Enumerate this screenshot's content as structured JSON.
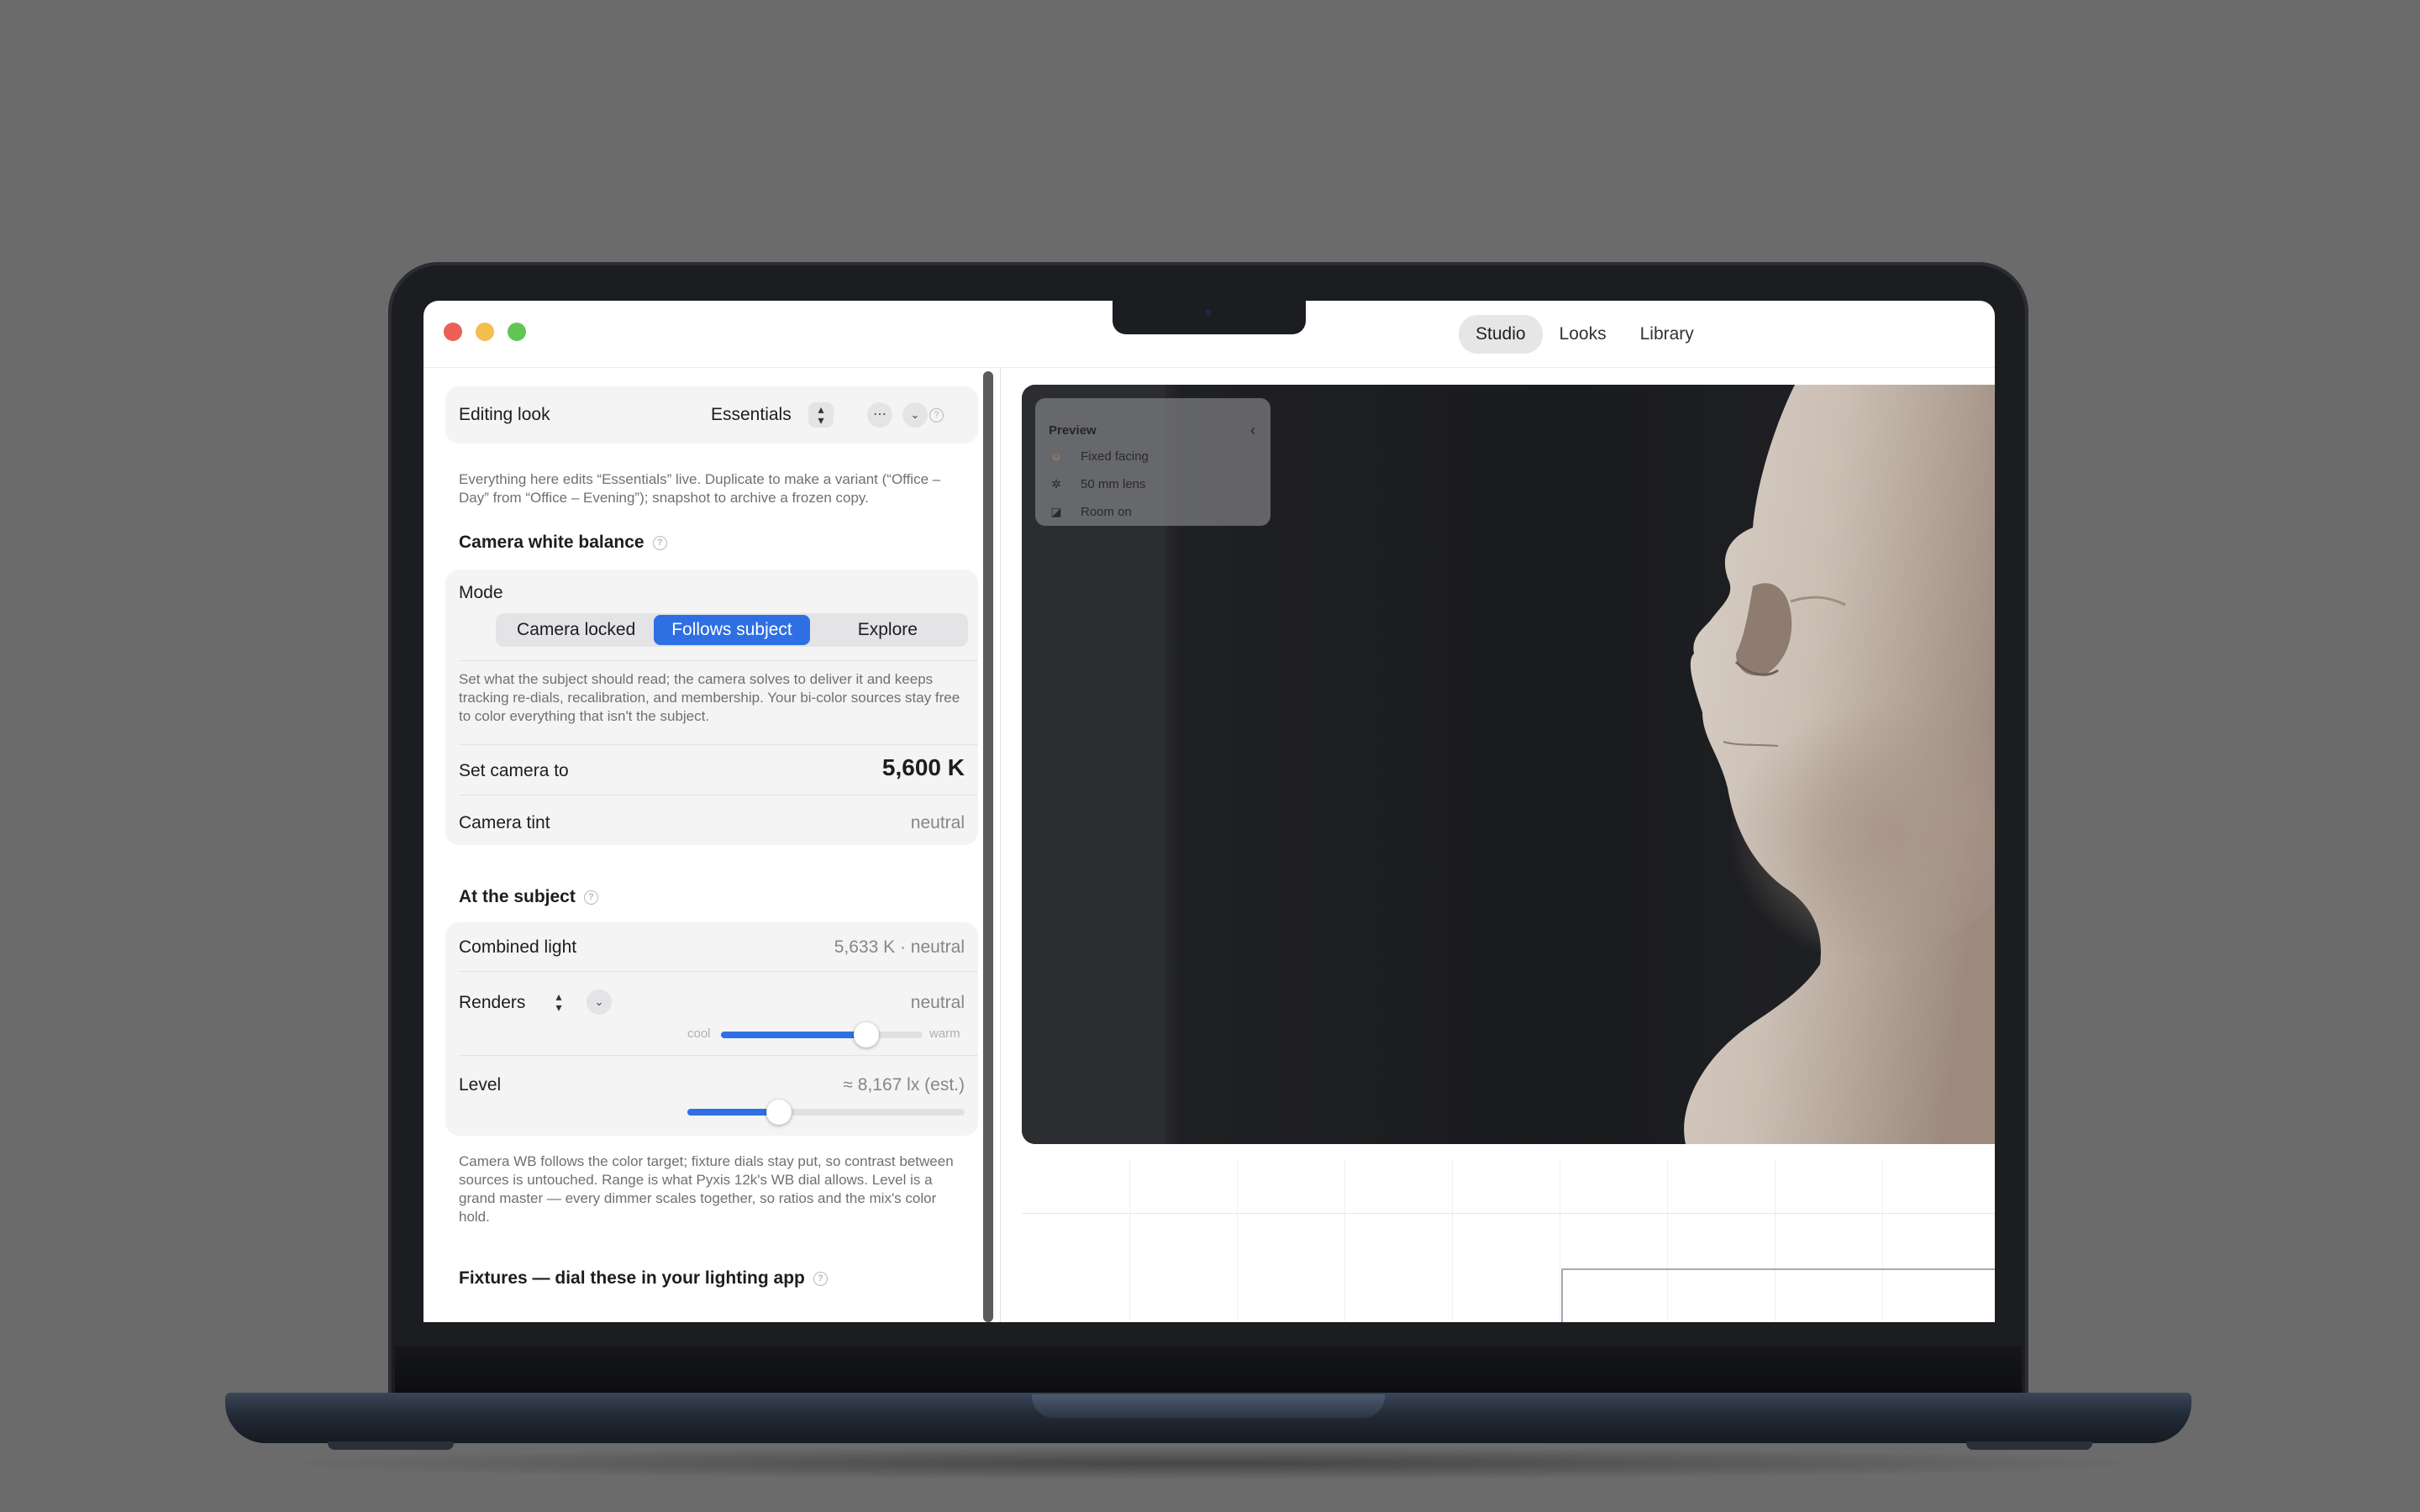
{
  "window": {
    "top_tabs": [
      "Studio",
      "Looks",
      "Library"
    ],
    "active_tab": "Studio"
  },
  "editing_look": {
    "label": "Editing look",
    "value": "Essentials",
    "hint": "Everything here edits “Essentials” live. Duplicate to make a variant (“Office – Day” from “Office – Evening”); snapshot to archive a frozen copy."
  },
  "camera_white_balance": {
    "title": "Camera white balance",
    "mode_label": "Mode",
    "modes": [
      "Camera locked",
      "Follows subject",
      "Explore"
    ],
    "active_mode": "Follows subject",
    "mode_hint": "Set what the subject should read; the camera solves to deliver it and keeps tracking re-dials, recalibration, and membership. Your bi-color sources stay free to color everything that isn't the subject.",
    "set_camera_label": "Set camera to",
    "set_camera_value": "5,600 K",
    "tint_label": "Camera tint",
    "tint_value": "neutral"
  },
  "at_subject": {
    "title": "At the subject",
    "combined_label": "Combined light",
    "combined_value": "5,633 K · neutral",
    "renders_label": "Renders",
    "renders_value": "neutral",
    "renders_cool": "cool",
    "renders_warm": "warm",
    "renders_level": 0.72,
    "level_label": "Level",
    "level_value": "≈ 8,167 lx (est.)",
    "level_level": 0.33,
    "hint": "Camera WB follows the color target; fixture dials stay put, so contrast between sources is untouched. Range is what Pyxis 12k's WB dial allows. Level is a grand master — every dimmer scales together, so ratios and the mix's color hold."
  },
  "fixtures": {
    "title": "Fixtures — dial these in your lighting app"
  },
  "preview": {
    "title": "Preview",
    "items": [
      {
        "icon": "face-icon",
        "label": "Fixed facing"
      },
      {
        "icon": "aperture-icon",
        "label": "50 mm lens"
      },
      {
        "icon": "room-icon",
        "label": "Room on"
      }
    ]
  },
  "colors": {
    "accent": "#2f6fe4",
    "close": "#ec5f57",
    "minimize": "#f4bd4f",
    "maximize": "#61c554"
  }
}
